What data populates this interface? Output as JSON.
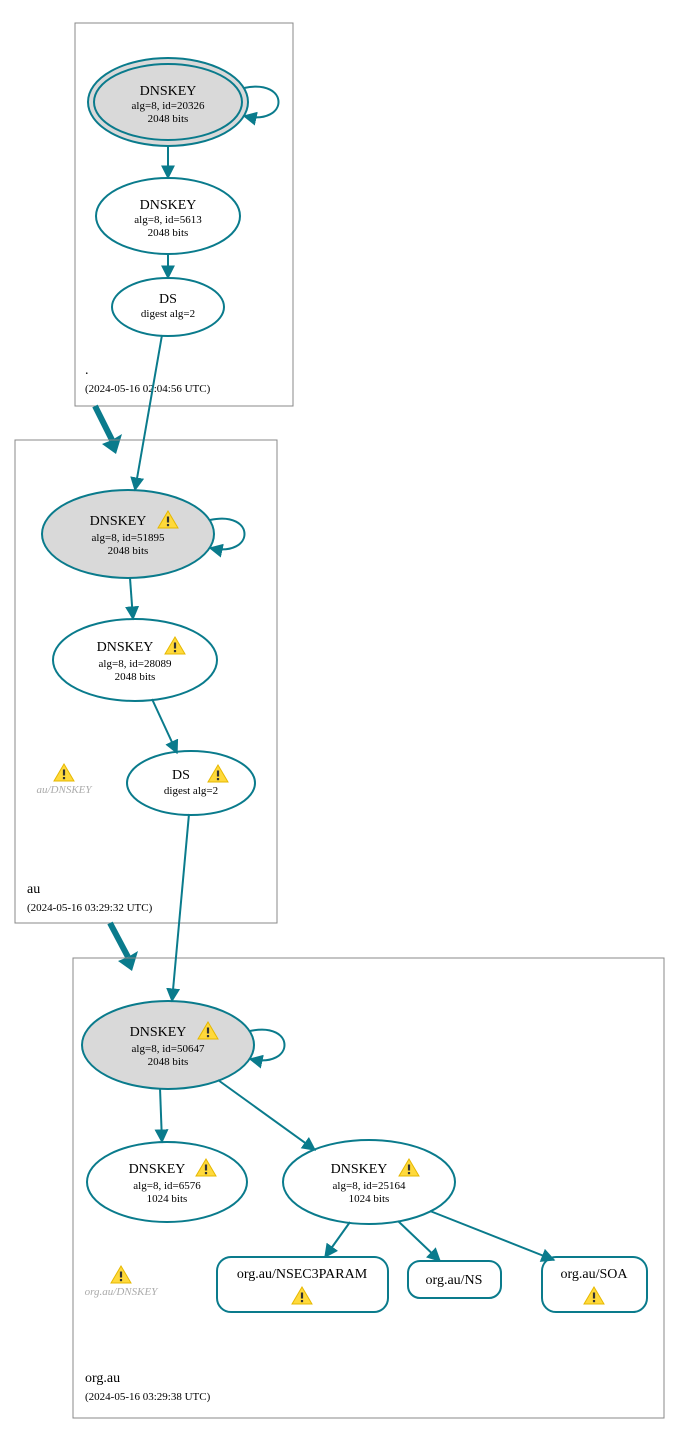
{
  "zones": {
    "root": {
      "name": ".",
      "timestamp": "(2024-05-16 02:04:56 UTC)"
    },
    "au": {
      "name": "au",
      "timestamp": "(2024-05-16 03:29:32 UTC)"
    },
    "org": {
      "name": "org.au",
      "timestamp": "(2024-05-16 03:29:38 UTC)"
    }
  },
  "nodes": {
    "root_ksk": {
      "title": "DNSKEY",
      "l1": "alg=8, id=20326",
      "l2": "2048 bits"
    },
    "root_zsk": {
      "title": "DNSKEY",
      "l1": "alg=8, id=5613",
      "l2": "2048 bits"
    },
    "root_ds": {
      "title": "DS",
      "l1": "digest alg=2"
    },
    "au_ksk": {
      "title": "DNSKEY",
      "l1": "alg=8, id=51895",
      "l2": "2048 bits"
    },
    "au_zsk": {
      "title": "DNSKEY",
      "l1": "alg=8, id=28089",
      "l2": "2048 bits"
    },
    "au_ds": {
      "title": "DS",
      "l1": "digest alg=2"
    },
    "org_ksk": {
      "title": "DNSKEY",
      "l1": "alg=8, id=50647",
      "l2": "2048 bits"
    },
    "org_zsk1": {
      "title": "DNSKEY",
      "l1": "alg=8, id=6576",
      "l2": "1024 bits"
    },
    "org_zsk2": {
      "title": "DNSKEY",
      "l1": "alg=8, id=25164",
      "l2": "1024 bits"
    },
    "org_nsec3": {
      "title": "org.au/NSEC3PARAM"
    },
    "org_ns": {
      "title": "org.au/NS"
    },
    "org_soa": {
      "title": "org.au/SOA"
    }
  },
  "ghosts": {
    "au": "au/DNSKEY",
    "org": "org.au/DNSKEY"
  }
}
